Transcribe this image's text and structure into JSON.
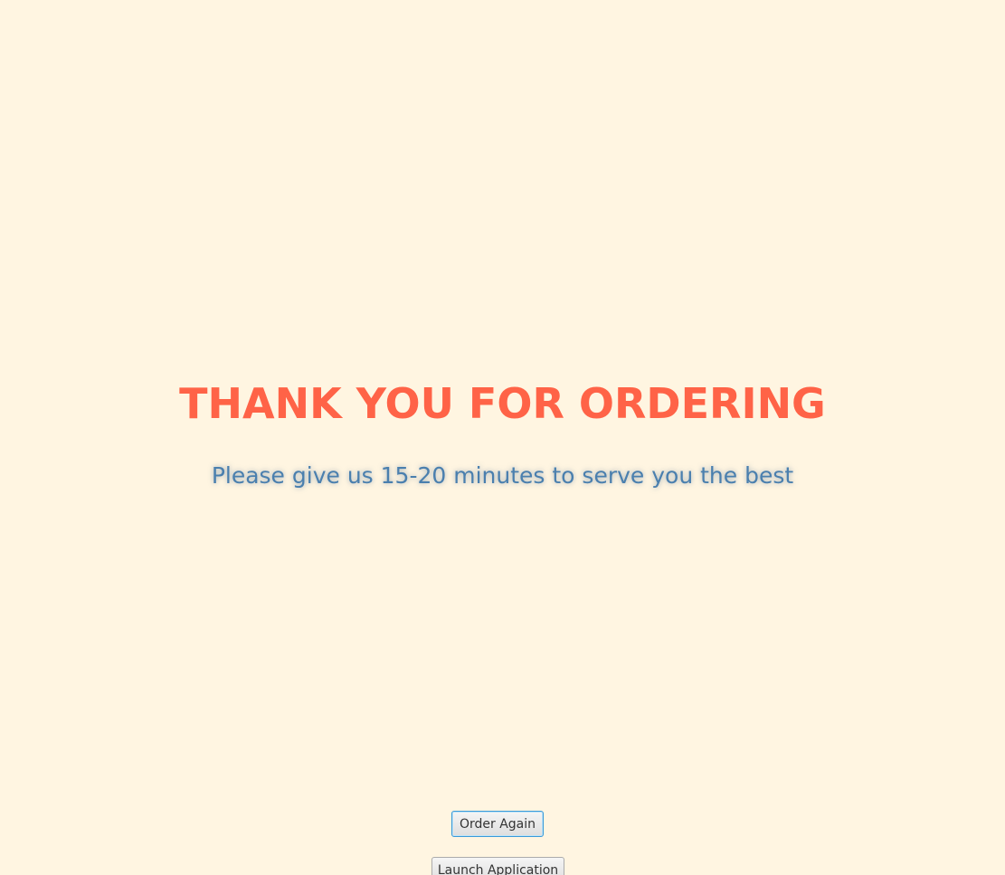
{
  "confirmation": {
    "title": "THANK YOU FOR ORDERING",
    "message": "Please give us 15-20 minutes to serve you the best"
  },
  "actions": {
    "order_again_label": "Order Again",
    "launch_application_label": "Launch Application"
  },
  "colors": {
    "background": "#FFF5E1",
    "title": "#FF6347",
    "message": "#4A7FAE",
    "focus_border": "#3A9AD9"
  }
}
